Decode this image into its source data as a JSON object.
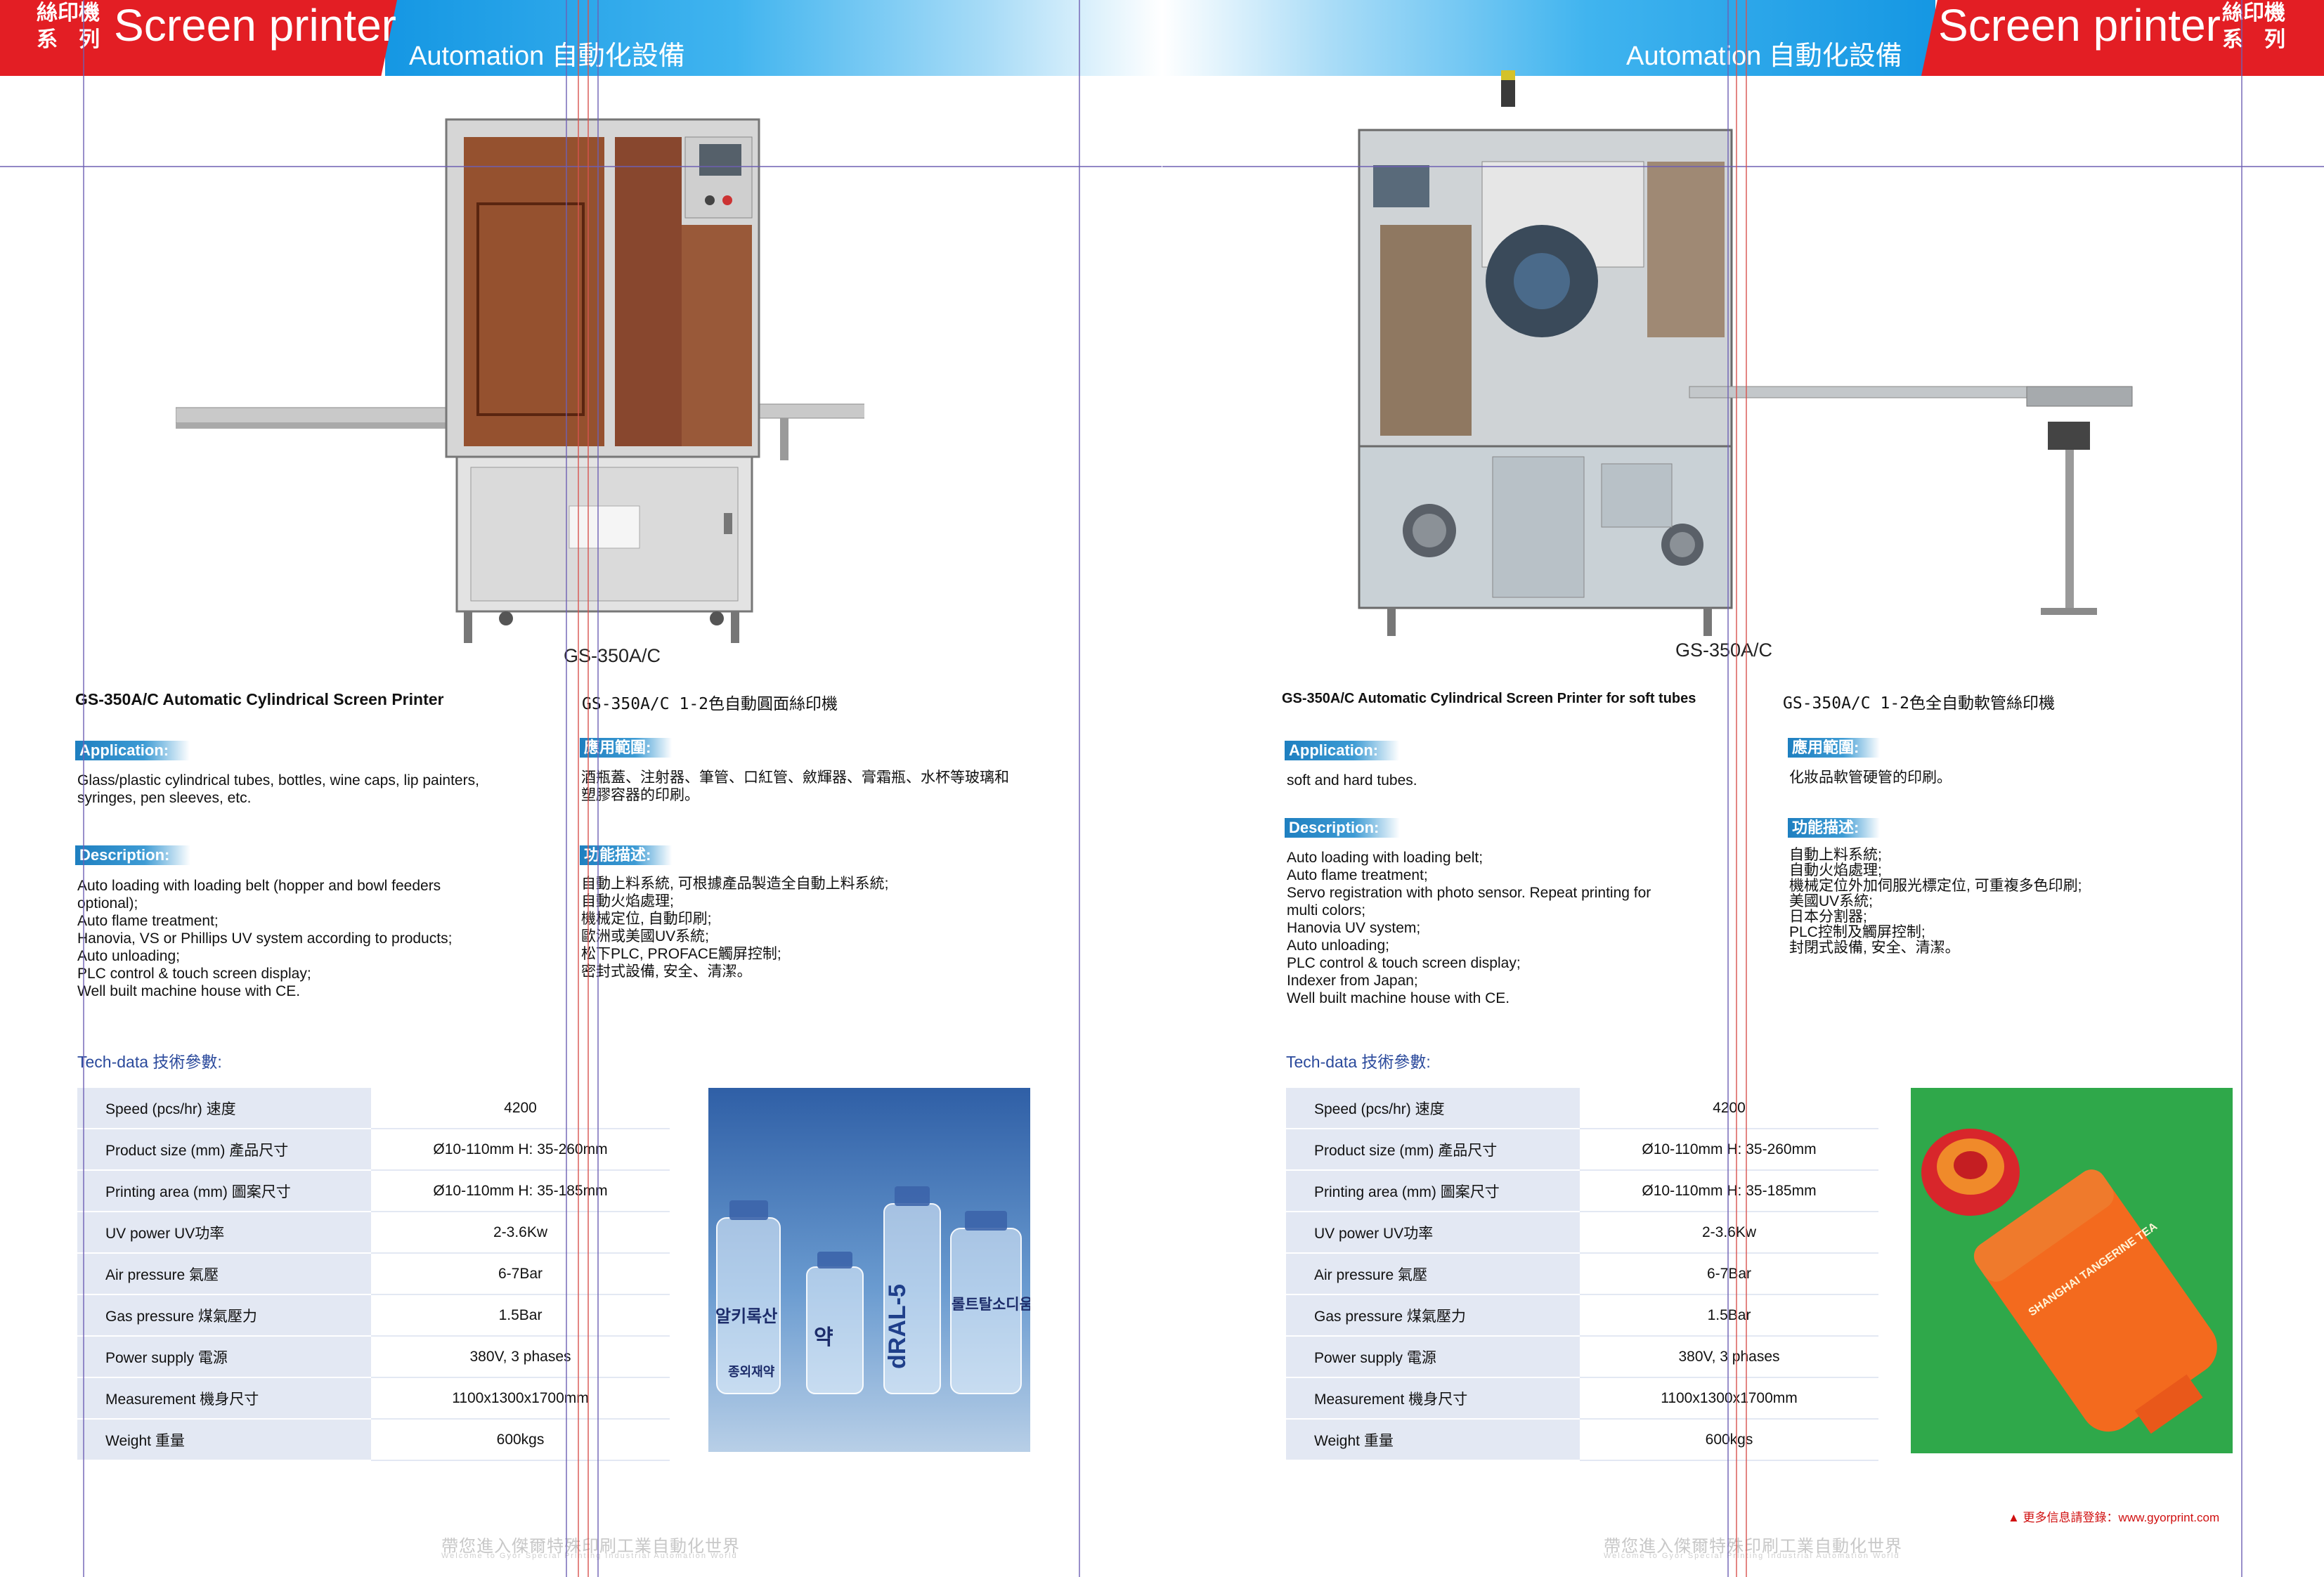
{
  "header": {
    "series_title": "Screen printer",
    "series_cn_top": "絲印機",
    "series_cn_bottom": "系　列",
    "automation": "Automation 自動化設備"
  },
  "left": {
    "model_label": "GS-350A/C",
    "title_en": "GS-350A/C   Automatic Cylindrical Screen Printer",
    "title_cn": "GS-350A/C  1-2色自動圓面絲印機",
    "application_tag": "Application:",
    "application_text": "Glass/plastic cylindrical tubes, bottles, wine caps, lip painters,\nsyringes, pen sleeves, etc.",
    "application_cn_tag": "應用範圍:",
    "application_cn_text": "酒瓶蓋、注射器、筆管、口紅管、斂輝器、膏霜瓶、水杯等玻璃和\n塑膠容器的印刷。",
    "description_tag": "Description:",
    "description_text": " Auto loading with loading belt (hopper and bowl feeders\n  optional);\nAuto flame treatment;\nHanovia, VS or Phillips UV system according to products;\nAuto unloading;\nPLC control & touch screen display;\nWell built machine house with CE.",
    "description_cn_tag": "功能描述:",
    "description_cn_text": "自動上料系統, 可根據產品製造全自動上料系統;\n自動火焰處理;\n機械定位, 自動印刷;\n歐洲或美國UV系統;\n松下PLC, PROFACE觸屏控制;\n密封式設備, 安全、清潔。",
    "tech_label": "Tech-data  技術參數:",
    "specs": [
      {
        "label": "Speed (pcs/hr)  速度",
        "value": "4200"
      },
      {
        "label": "Product size (mm)  產品尺寸",
        "value": "Ø10-110mm        H: 35-260mm"
      },
      {
        "label": "Printing area (mm)  圖案尺寸",
        "value": "Ø10-110mm         H: 35-185mm"
      },
      {
        "label": "UV power  UV功率",
        "value": "2-3.6Kw"
      },
      {
        "label": "Air pressure  氣壓",
        "value": "6-7Bar"
      },
      {
        "label": "Gas pressure  煤氣壓力",
        "value": "1.5Bar"
      },
      {
        "label": "Power supply  電源",
        "value": "380V, 3 phases"
      },
      {
        "label": "Measurement  機身尺寸",
        "value": "1100x1300x1700mm"
      },
      {
        "label": "Weight  重量",
        "value": "600kgs"
      }
    ],
    "vial_labels": [
      "알키록산",
      "약",
      "dRAL-5",
      "롤트탈소디움"
    ],
    "vial_brand": "종외재약",
    "footer": "帶您進入傑爾特殊印刷工業自動化世界",
    "footer_sub": "Welcome to  Gyor Special Printing Industrial Automation World"
  },
  "right": {
    "model_label": "GS-350A/C",
    "title_en": "GS-350A/C   Automatic Cylindrical Screen Printer for soft tubes",
    "title_cn": "GS-350A/C 1-2色全自動軟管絲印機",
    "application_tag": "Application:",
    "application_text": "soft and hard tubes.",
    "application_cn_tag": "應用範圍:",
    "application_cn_text": "化妝品軟管硬管的印刷。",
    "description_tag": "Description:",
    "description_text": "Auto loading with loading belt;\nAuto flame treatment;\nServo registration with photo sensor. Repeat printing for\nmulti colors;\nHanovia UV system;\nAuto unloading;\nPLC control & touch screen display;\nIndexer from Japan;\nWell built machine house with CE.",
    "description_cn_tag": "功能描述:",
    "description_cn_text": "自動上料系統;\n自動火焰處理;\n機械定位外加伺服光標定位, 可重複多色印刷;\n美國UV系統;\n日本分割器;\nPLC控制及觸屏控制;\n封閉式設備, 安全、清潔。",
    "tech_label": "Tech-data  技術參數:",
    "specs": [
      {
        "label": "Speed (pcs/hr)  速度",
        "value": "4200"
      },
      {
        "label": "Product size (mm)  產品尺寸",
        "value": "Ø10-110mm        H: 35-260mm"
      },
      {
        "label": "Printing area (mm)  圖案尺寸",
        "value": "Ø10-110mm         H: 35-185mm"
      },
      {
        "label": "UV power  UV功率",
        "value": "2-3.6Kw"
      },
      {
        "label": "Air pressure  氣壓",
        "value": "6-7Bar"
      },
      {
        "label": "Gas pressure  煤氣壓力",
        "value": "1.5Bar"
      },
      {
        "label": "Power supply  電源",
        "value": "380V, 3 phases"
      },
      {
        "label": "Measurement  機身尺寸",
        "value": "1100x1300x1700mm"
      },
      {
        "label": "Weight  重量",
        "value": "600kgs"
      }
    ],
    "tube_label": "SHANGHAI TANGERINE TEA",
    "footer": "帶您進入傑爾特殊印刷工業自動化世界",
    "footer_sub": "Welcome to  Gyor Special Printing Industrial Automation World",
    "weblink": "▲ 更多信息請登錄：www.gyorprint.com"
  },
  "colors": {
    "header_red": "#e31e24",
    "header_blue": "#1597e3",
    "tag_blue": "#1e7fc0",
    "table_label_bg": "#e3e8f3",
    "guide_purple": "#6e5fb3",
    "guide_red": "#d9534f",
    "vial_photo_bg": "#5a86c0",
    "tube_photo_bg": "#2fa84a"
  }
}
